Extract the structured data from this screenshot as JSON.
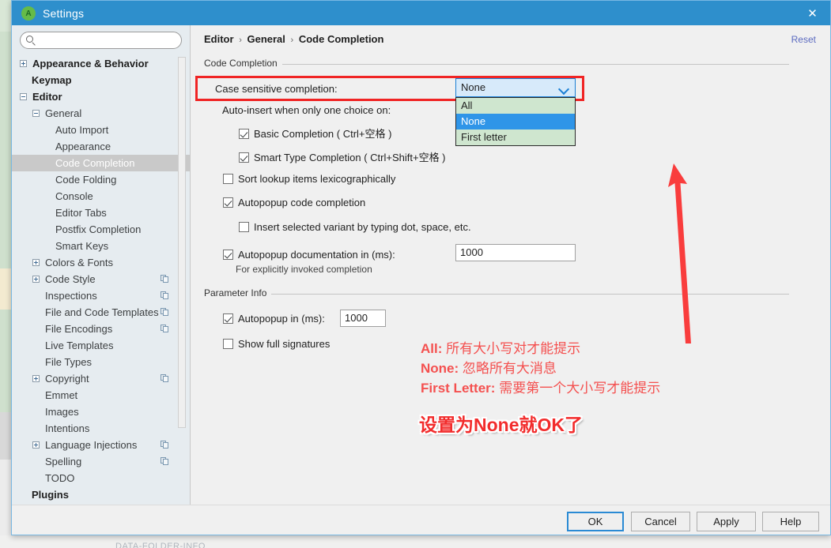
{
  "window": {
    "title": "Settings",
    "icon": "android-studio-icon",
    "close_label": "✕",
    "accent_blue": "#2e8fcc"
  },
  "sidebar": {
    "search_placeholder": "",
    "search_value": "",
    "search_icon": "search-icon",
    "items": [
      {
        "label": "Appearance & Behavior",
        "indent": 10,
        "toggle": "plus",
        "bold": true,
        "selected": false,
        "copy": false
      },
      {
        "label": "Keymap",
        "indent": 25,
        "toggle": "none",
        "bold": true,
        "selected": false,
        "copy": false
      },
      {
        "label": "Editor",
        "indent": 10,
        "toggle": "minus",
        "bold": true,
        "selected": false,
        "copy": false
      },
      {
        "label": "General",
        "indent": 26,
        "toggle": "minus",
        "bold": false,
        "selected": false,
        "copy": false
      },
      {
        "label": "Auto Import",
        "indent": 55,
        "toggle": "none",
        "bold": false,
        "selected": false,
        "copy": false
      },
      {
        "label": "Appearance",
        "indent": 55,
        "toggle": "none",
        "bold": false,
        "selected": false,
        "copy": false
      },
      {
        "label": "Code Completion",
        "indent": 55,
        "toggle": "none",
        "bold": false,
        "selected": true,
        "copy": false
      },
      {
        "label": "Code Folding",
        "indent": 55,
        "toggle": "none",
        "bold": false,
        "selected": false,
        "copy": false
      },
      {
        "label": "Console",
        "indent": 55,
        "toggle": "none",
        "bold": false,
        "selected": false,
        "copy": false
      },
      {
        "label": "Editor Tabs",
        "indent": 55,
        "toggle": "none",
        "bold": false,
        "selected": false,
        "copy": false
      },
      {
        "label": "Postfix Completion",
        "indent": 55,
        "toggle": "none",
        "bold": false,
        "selected": false,
        "copy": false
      },
      {
        "label": "Smart Keys",
        "indent": 55,
        "toggle": "none",
        "bold": false,
        "selected": false,
        "copy": false
      },
      {
        "label": "Colors & Fonts",
        "indent": 26,
        "toggle": "plus",
        "bold": false,
        "selected": false,
        "copy": false
      },
      {
        "label": "Code Style",
        "indent": 26,
        "toggle": "plus",
        "bold": false,
        "selected": false,
        "copy": true
      },
      {
        "label": "Inspections",
        "indent": 42,
        "toggle": "none",
        "bold": false,
        "selected": false,
        "copy": true
      },
      {
        "label": "File and Code Templates",
        "indent": 42,
        "toggle": "none",
        "bold": false,
        "selected": false,
        "copy": true
      },
      {
        "label": "File Encodings",
        "indent": 42,
        "toggle": "none",
        "bold": false,
        "selected": false,
        "copy": true
      },
      {
        "label": "Live Templates",
        "indent": 42,
        "toggle": "none",
        "bold": false,
        "selected": false,
        "copy": false
      },
      {
        "label": "File Types",
        "indent": 42,
        "toggle": "none",
        "bold": false,
        "selected": false,
        "copy": false
      },
      {
        "label": "Copyright",
        "indent": 26,
        "toggle": "plus",
        "bold": false,
        "selected": false,
        "copy": true
      },
      {
        "label": "Emmet",
        "indent": 42,
        "toggle": "none",
        "bold": false,
        "selected": false,
        "copy": false
      },
      {
        "label": "Images",
        "indent": 42,
        "toggle": "none",
        "bold": false,
        "selected": false,
        "copy": false
      },
      {
        "label": "Intentions",
        "indent": 42,
        "toggle": "none",
        "bold": false,
        "selected": false,
        "copy": false
      },
      {
        "label": "Language Injections",
        "indent": 26,
        "toggle": "plus",
        "bold": false,
        "selected": false,
        "copy": true
      },
      {
        "label": "Spelling",
        "indent": 42,
        "toggle": "none",
        "bold": false,
        "selected": false,
        "copy": true
      },
      {
        "label": "TODO",
        "indent": 42,
        "toggle": "none",
        "bold": false,
        "selected": false,
        "copy": false
      },
      {
        "label": "Plugins",
        "indent": 25,
        "toggle": "none",
        "bold": true,
        "selected": false,
        "copy": false
      }
    ]
  },
  "panel": {
    "breadcrumb": {
      "part1": "Editor",
      "part2": "General",
      "part3": "Code Completion",
      "separator": "›"
    },
    "reset_label": "Reset",
    "group_code_completion": {
      "title": "Code Completion",
      "case_sensitive_label": "Case sensitive completion:",
      "case_sensitive_value": "None",
      "case_sensitive_options": [
        "All",
        "None",
        "First letter"
      ],
      "case_sensitive_selected_index": 1,
      "auto_insert_label": "Auto-insert when only one choice on:",
      "basic_completion": {
        "label": "Basic Completion ( Ctrl+空格 )",
        "checked": true
      },
      "smart_type_completion": {
        "label": "Smart Type Completion ( Ctrl+Shift+空格 )",
        "checked": true
      },
      "sort_lookup": {
        "label": "Sort lookup items lexicographically",
        "checked": false
      },
      "autopopup_code": {
        "label": "Autopopup code completion",
        "checked": true
      },
      "insert_selected_variant": {
        "label": "Insert selected variant by typing dot, space, etc.",
        "checked": false
      },
      "autopopup_doc": {
        "label": "Autopopup documentation in (ms):",
        "checked": true,
        "value": "1000"
      },
      "autopopup_doc_note": "For explicitly invoked completion"
    },
    "group_parameter_info": {
      "title": "Parameter Info",
      "autopopup_in": {
        "label": "Autopopup in (ms):",
        "checked": true,
        "value": "1000"
      },
      "show_full_signatures": {
        "label": "Show full signatures",
        "checked": false
      }
    }
  },
  "annotations": {
    "line1_key": "All:",
    "line1_text": " 所有大小写对才能提示",
    "line2_key": "None:",
    "line2_text": " 忽略所有大消息",
    "line3_key": "First Letter:",
    "line3_text": " 需要第一个大小写才能提示",
    "conclusion": "设置为None就OK了",
    "arrow": "red-arrow-up",
    "highlight_color": "#f02424",
    "text_color": "#f4504f"
  },
  "footer": {
    "ok_label": "OK",
    "cancel_label": "Cancel",
    "apply_label": "Apply",
    "help_label": "Help"
  },
  "background": {
    "bottom_text": "DATA-FOLDER-INFO"
  }
}
